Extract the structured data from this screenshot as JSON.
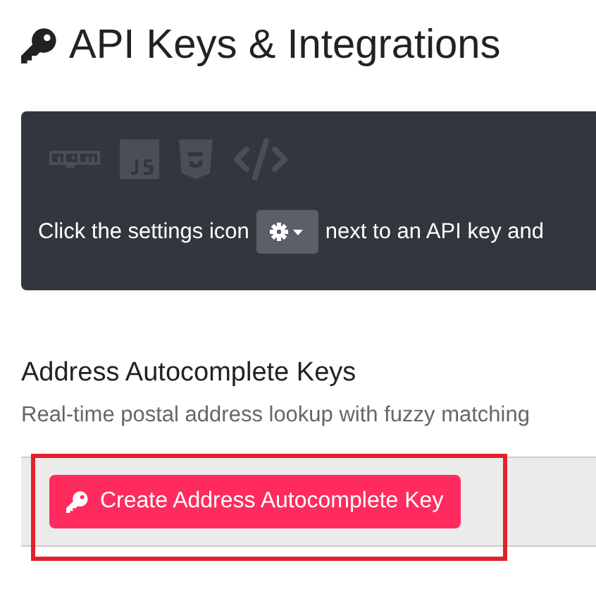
{
  "page": {
    "title": "API Keys & Integrations"
  },
  "info_panel": {
    "text_before": "Click the settings icon",
    "text_after": "next to an API key and"
  },
  "section": {
    "heading": "Address Autocomplete Keys",
    "description": "Real-time postal address lookup with fuzzy matching",
    "button": "Create Address Autocomplete Key",
    "highlighted": true
  }
}
